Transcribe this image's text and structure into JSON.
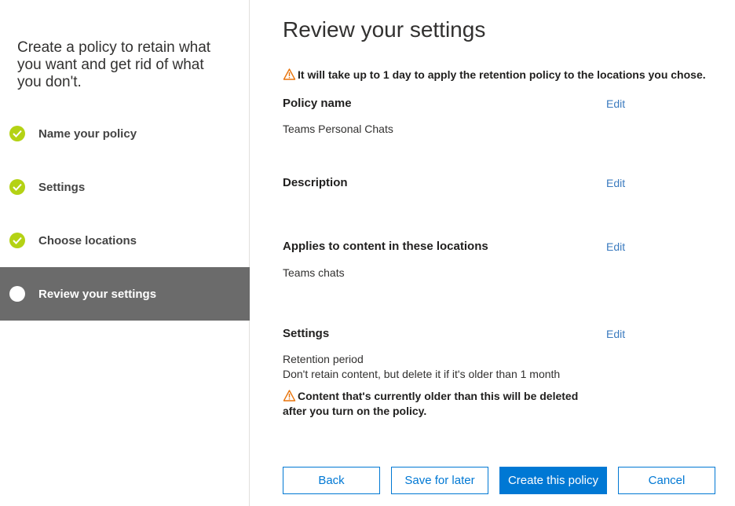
{
  "sidebar": {
    "title": "Create a policy to retain what you want and get rid of what you don't.",
    "steps": [
      {
        "label": "Name your policy",
        "state": "done"
      },
      {
        "label": "Settings",
        "state": "done"
      },
      {
        "label": "Choose locations",
        "state": "done"
      },
      {
        "label": "Review your settings",
        "state": "current"
      }
    ]
  },
  "main": {
    "title": "Review your settings",
    "top_warning": "It will take up to 1 day to apply the retention policy to the locations you chose.",
    "sections": {
      "policy_name": {
        "heading": "Policy name",
        "edit": "Edit",
        "value": "Teams Personal Chats"
      },
      "description": {
        "heading": "Description",
        "edit": "Edit"
      },
      "locations": {
        "heading": "Applies to content in these locations",
        "edit": "Edit",
        "value": "Teams chats"
      },
      "settings": {
        "heading": "Settings",
        "edit": "Edit",
        "retention_label": "Retention period",
        "retention_value": "Don't retain content, but delete it if it's older than 1 month",
        "warning": "Content that's currently older than this will be deleted after you turn on the policy."
      }
    }
  },
  "buttons": {
    "back": "Back",
    "save_for_later": "Save for later",
    "create": "Create this policy",
    "cancel": "Cancel"
  },
  "colors": {
    "accent": "#0078d4",
    "check": "#b4d214",
    "active_step_bg": "#6b6b6b",
    "warning": "#e8740c",
    "link": "#3b7bbf"
  }
}
